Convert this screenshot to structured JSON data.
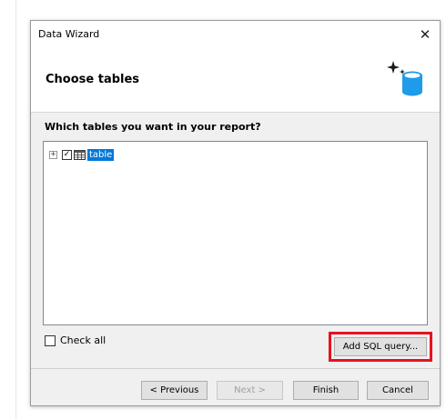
{
  "window": {
    "title": "Data Wizard",
    "close_symbol": "✕"
  },
  "header": {
    "title": "Choose tables",
    "icon": "database-sparkle-icon"
  },
  "prompt": "Which tables you want in your report?",
  "tree": {
    "items": [
      {
        "label": "table",
        "expander": "+",
        "checked": true,
        "check_mark": "✓",
        "selected": true,
        "icon": "table-grid-icon"
      }
    ]
  },
  "check_all": {
    "label": "Check all",
    "checked": false
  },
  "buttons": {
    "add_sql": "Add SQL query...",
    "previous": "< Previous",
    "next": "Next >",
    "finish": "Finish",
    "cancel": "Cancel"
  },
  "colors": {
    "highlight_border": "#e8111f",
    "selection": "#0078d7",
    "db_icon": "#1e9be9"
  }
}
